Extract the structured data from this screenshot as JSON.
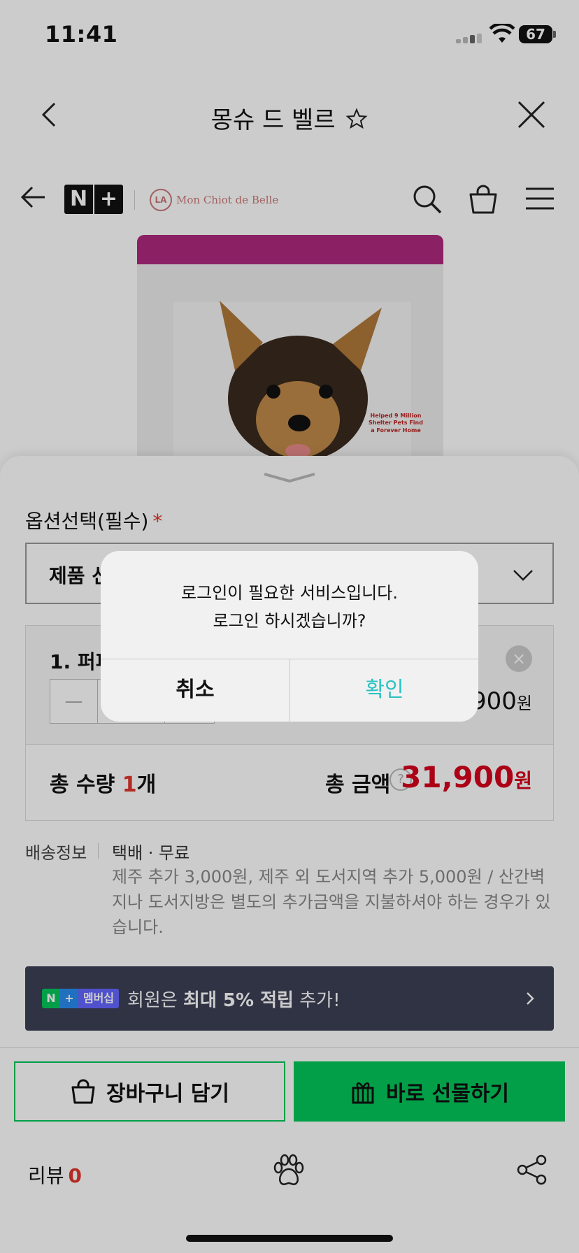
{
  "status_bar": {
    "time": "11:41",
    "battery": "67"
  },
  "title_bar": {
    "title": "몽슈 드 벨르"
  },
  "store_header": {
    "n_logo": "N",
    "plus_logo": "+",
    "brand_name": "Mon Chiot de Belle"
  },
  "product": {
    "bag_text": "Helped 9 Million Shelter Pets Find a Forever Home"
  },
  "options": {
    "label": "옵션선택(필수)",
    "required_mark": "*",
    "select_value": "제품 선"
  },
  "cart_item": {
    "name": "1. 퍼피",
    "quantity": "1",
    "price": "31,900",
    "price_unit": "원",
    "remove": "×",
    "minus": "—",
    "plus": "+"
  },
  "totals": {
    "qty_label": "총 수량",
    "qty_value": "1",
    "qty_unit": "개",
    "amount_label": "총 금액",
    "help": "?",
    "amount_value": "31,900",
    "amount_unit": "원"
  },
  "shipping": {
    "label": "배송정보",
    "method": "택배 · 무료",
    "note": "제주 추가 3,000원, 제주 외 도서지역 추가 5,000원 / 산간벽지나 도서지방은 별도의 추가금액을 지불하셔야 하는 경우가 있습니다."
  },
  "membership": {
    "badge_n": "N",
    "badge_plus": "+",
    "badge_text": "멤버십",
    "text_prefix": "회원은 ",
    "text_bold": "최대 5% 적립",
    "text_suffix": " 추가!"
  },
  "actions": {
    "cart_label": "장바구니 담기",
    "gift_label": "바로 선물하기"
  },
  "footer": {
    "review_label": "리뷰",
    "review_count": "0"
  },
  "alert": {
    "line1": "로그인이 필요한 서비스입니다.",
    "line2": "로그인 하시겠습니까?",
    "cancel": "취소",
    "ok": "확인"
  },
  "colors": {
    "naver_green": "#03c75a",
    "price_red": "#d6001c",
    "alert_ok": "#29c3c3",
    "membership_bg": "#3b4055"
  }
}
